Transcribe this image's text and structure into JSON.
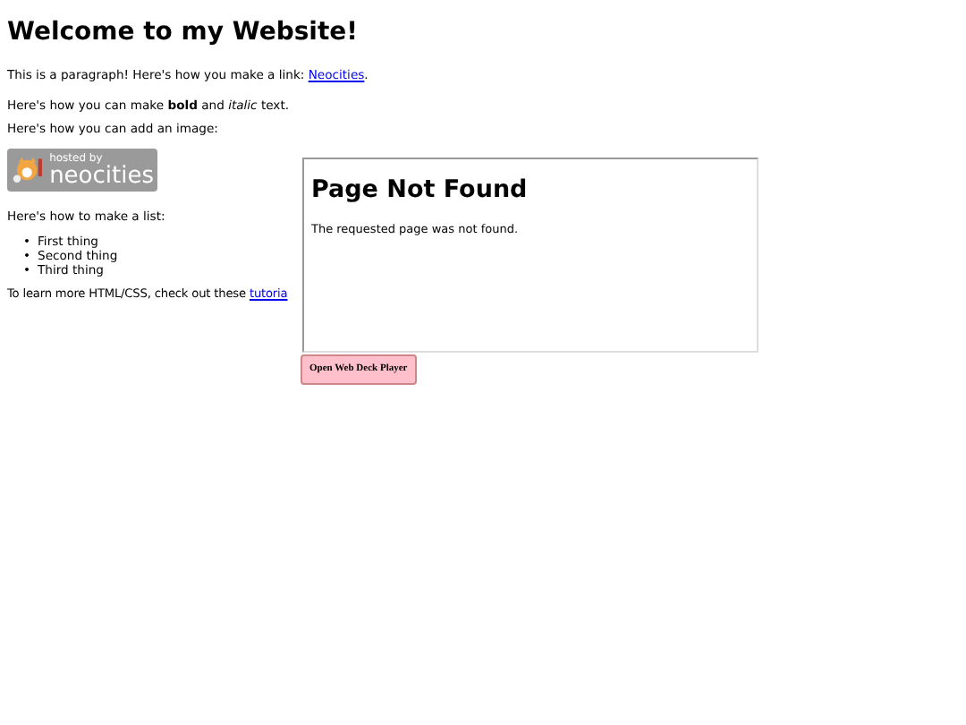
{
  "heading": "Welcome to my Website!",
  "paragraph_1": {
    "text": "This is a paragraph! Here's how you make a link: ",
    "link": "Neocities",
    "after": "."
  },
  "paragraph_2": "Here's how you can make **bold** and *italic* text.",
  "paragraph_3": "Here's how you can add an image:",
  "badge": {
    "line_1": "hosted by",
    "line_2": "neocities"
  },
  "list_intro": "Here's how to make a list:",
  "list": [
    {
      "marker": "•",
      "text": "First thing"
    },
    {
      "marker": "•",
      "text": "Second thing"
    },
    {
      "marker": "•",
      "text": "Third thing"
    }
  ],
  "paragraph_4": {
    "text": "To learn more HTML/CSS, check out these ",
    "link": "tutoria"
  },
  "frame": {
    "title": "Page Not Found",
    "message": "The requested page was not found."
  },
  "button": "Open Web Deck Player"
}
